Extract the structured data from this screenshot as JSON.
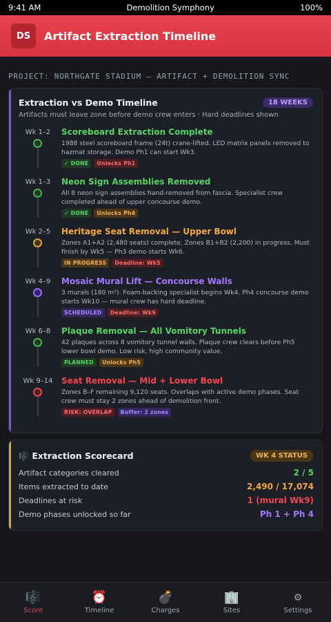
{
  "status_bar": {
    "time": "9:41 AM",
    "title": "Demolition Symphony",
    "battery": "100%"
  },
  "header": {
    "logo": "DS",
    "title": "Artifact Extraction Timeline"
  },
  "project_label": "PROJECT: NORTHGATE STADIUM — ARTIFACT + DEMOLITION SYNC",
  "timeline": {
    "title": "Extraction vs Demo Timeline",
    "badge": "18 WEEKS",
    "subtitle": "Artifacts must leave zone before demo crew enters · Hard deadlines shown",
    "entries": [
      {
        "week": "Wk 1–2",
        "title": "Scoreboard Extraction Complete",
        "title_color": "#56d364",
        "dot_color": "#3fb950",
        "dot_fill": "#1f3a26",
        "desc": "1988 steel scoreboard frame (24t) crane-lifted. LED matrix panels removed to hazmat storage. Demo Ph1 can start Wk3.",
        "tags": [
          {
            "text": "✓ DONE",
            "style": "green"
          },
          {
            "text": "Unlocks Ph1",
            "style": "red"
          }
        ]
      },
      {
        "week": "Wk 1–3",
        "title": "Neon Sign Assemblies Removed",
        "title_color": "#56d364",
        "dot_color": "#3fb950",
        "dot_fill": "#1f3a26",
        "desc": "All 8 neon sign assemblies hand-removed from fascia. Specialist crew completed ahead of upper concourse demo.",
        "tags": [
          {
            "text": "✓ DONE",
            "style": "green"
          },
          {
            "text": "Unlocks Ph4",
            "style": "amber"
          }
        ]
      },
      {
        "week": "Wk 2–5",
        "title": "Heritage Seat Removal — Upper Bowl",
        "title_color": "#f2a93b",
        "dot_color": "#e3a43a",
        "dot_fill": "#4a3718",
        "desc": "Zones A1+A2 (2,480 seats) complete. Zones B1+B2 (2,200) in progress. Must finish by Wk5 — Ph3 demo starts Wk6.",
        "tags": [
          {
            "text": "IN PROGRESS",
            "style": "amber"
          },
          {
            "text": "Deadline: Wk5",
            "style": "red"
          }
        ]
      },
      {
        "week": "Wk 4–9",
        "title": "Mosaic Mural Lift — Concourse Walls",
        "title_color": "#a678ff",
        "dot_color": "#9b6dff",
        "dot_fill": "#342760",
        "desc": "3 murals (180 m²). Foam-backing specialist begins Wk4. Ph4 concourse demo starts Wk10 — mural crew has hard deadline.",
        "tags": [
          {
            "text": "SCHEDULED",
            "style": "purple"
          },
          {
            "text": "Deadline: Wk9",
            "style": "red"
          }
        ]
      },
      {
        "week": "Wk 6–8",
        "title": "Plaque Removal — All Vomitory Tunnels",
        "title_color": "#56d364",
        "dot_color": "#3fb950",
        "dot_fill": "#1f3a26",
        "desc": "42 plaques across 8 vomitory tunnel walls. Plaque crew clears before Ph5 lower bowl demo. Low risk, high community value.",
        "tags": [
          {
            "text": "PLANNED",
            "style": "green"
          },
          {
            "text": "Unlocks Ph5",
            "style": "amber"
          }
        ]
      },
      {
        "week": "Wk 9–14",
        "title": "Seat Removal — Mid + Lower Bowl",
        "title_color": "#f0474f",
        "dot_color": "#f0474f",
        "dot_fill": "#4a1e22",
        "desc": "Zones B–F remaining 9,120 seats. Overlaps with active demo phases. Seat crew must stay 2 zones ahead of demolition front.",
        "tags": [
          {
            "text": "RISK: OVERLAP",
            "style": "red"
          },
          {
            "text": "Buffer: 2 zones",
            "style": "purple"
          }
        ]
      }
    ]
  },
  "scorecard": {
    "icon": "score-icon",
    "title": "Extraction Scorecard",
    "badge": "WK 4 STATUS",
    "rows": [
      {
        "label": "Artifact categories cleared",
        "value": "2 / 5",
        "color": "#56d364"
      },
      {
        "label": "Items extracted to date",
        "value": "2,490 / 17,074",
        "color": "#f2a93b"
      },
      {
        "label": "Deadlines at risk",
        "value": "1 (mural Wk9)",
        "color": "#f0474f"
      },
      {
        "label": "Demo phases unlocked so far",
        "value": "Ph 1 + Ph 4",
        "color": "#a678ff"
      }
    ]
  },
  "nav": [
    {
      "label": "Score",
      "icon": "🎼",
      "icon_name": "score-icon",
      "active": true
    },
    {
      "label": "Timeline",
      "icon": "⏰",
      "icon_name": "alarm-clock-icon",
      "active": false
    },
    {
      "label": "Charges",
      "icon": "💣",
      "icon_name": "bomb-icon",
      "active": false
    },
    {
      "label": "Sites",
      "icon": "🏢",
      "icon_name": "building-icon",
      "active": false
    },
    {
      "label": "Settings",
      "icon": "⚙",
      "icon_name": "gear-icon",
      "active": false
    }
  ]
}
